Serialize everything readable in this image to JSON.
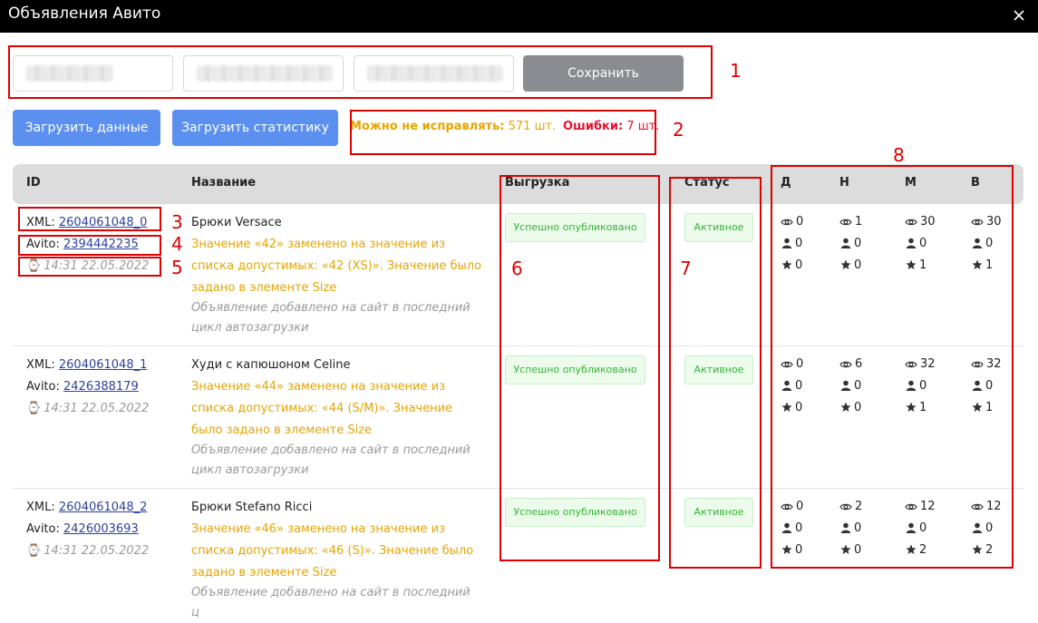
{
  "window": {
    "title": "Объявления Авито"
  },
  "toolbar": {
    "save_label": "Сохранить",
    "load_data_label": "Загрузить данные",
    "load_stats_label": "Загрузить статистику"
  },
  "summary": {
    "ok_label": "Можно не исправлять:",
    "ok_value": "571 шт.",
    "err_label": "Ошибки:",
    "err_value": "7 шт."
  },
  "table": {
    "headers": {
      "id": "ID",
      "name": "Название",
      "upload": "Выгрузка",
      "status": "Статус",
      "d": "Д",
      "n": "Н",
      "m": "М",
      "v": "В"
    },
    "xml_prefix": "XML: ",
    "avito_prefix": "Avito: ",
    "rows": [
      {
        "xml_id": "2604061048_0",
        "avito_id": "2394442235",
        "time": "14:31 22.05.2022",
        "name": "Брюки Versace",
        "warning": "Значение «42» заменено на значение из списка допустимых: «42 (XS)». Значение было задано в элементе Size",
        "note": "Объявление добавлено на сайт в последний цикл автозагрузки",
        "upload": "Успешно опубликовано",
        "status": "Активное",
        "stats": {
          "d": {
            "views": "0",
            "contacts": "0",
            "favorites": "0"
          },
          "n": {
            "views": "1",
            "contacts": "0",
            "favorites": "0"
          },
          "m": {
            "views": "30",
            "contacts": "0",
            "favorites": "1"
          },
          "v": {
            "views": "30",
            "contacts": "0",
            "favorites": "1"
          }
        }
      },
      {
        "xml_id": "2604061048_1",
        "avito_id": "2426388179",
        "time": "14:31 22.05.2022",
        "name": "Худи с капюшоном Celine",
        "warning": "Значение «44» заменено на значение из списка допустимых: «44 (S/M)». Значение было задано в элементе Size",
        "note": "Объявление добавлено на сайт в последний цикл автозагрузки",
        "upload": "Успешно опубликовано",
        "status": "Активное",
        "stats": {
          "d": {
            "views": "0",
            "contacts": "0",
            "favorites": "0"
          },
          "n": {
            "views": "6",
            "contacts": "0",
            "favorites": "0"
          },
          "m": {
            "views": "32",
            "contacts": "0",
            "favorites": "1"
          },
          "v": {
            "views": "32",
            "contacts": "0",
            "favorites": "1"
          }
        }
      },
      {
        "xml_id": "2604061048_2",
        "avito_id": "2426003693",
        "time": "14:31 22.05.2022",
        "name": "Брюки Stefano Ricci",
        "warning": "Значение «46» заменено на значение из списка допустимых: «46 (S)». Значение было задано в элементе Size",
        "note": "Объявление добавлено на сайт в последний ц",
        "upload": "Успешно опубликовано",
        "status": "Активное",
        "stats": {
          "d": {
            "views": "0",
            "contacts": "0",
            "favorites": "0"
          },
          "n": {
            "views": "2",
            "contacts": "0",
            "favorites": "0"
          },
          "m": {
            "views": "12",
            "contacts": "0",
            "favorites": "2"
          },
          "v": {
            "views": "12",
            "contacts": "0",
            "favorites": "2"
          }
        }
      }
    ]
  },
  "annotations": [
    "1",
    "2",
    "3",
    "4",
    "5",
    "6",
    "7",
    "8"
  ],
  "colors": {
    "accent": "#5b90f0",
    "save_button": "#8a8c91",
    "ok": "#e6a400",
    "error": "#e8112d",
    "badge_green": "#34b534",
    "annotation": "#e00000"
  }
}
